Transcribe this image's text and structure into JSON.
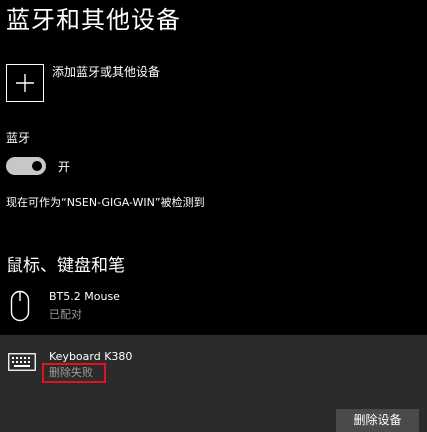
{
  "page": {
    "title": "蓝牙和其他设备"
  },
  "add_device": {
    "label": "添加蓝牙或其他设备",
    "icon": "plus-icon"
  },
  "bluetooth": {
    "label": "蓝牙",
    "toggle_on": true,
    "state_label": "开",
    "discoverable_text": "现在可作为“NSEN-GIGA-WIN”被检测到"
  },
  "section": {
    "title": "鼠标、键盘和笔"
  },
  "devices": [
    {
      "name": "BT5.2 Mouse",
      "status": "已配对",
      "icon": "mouse-icon"
    },
    {
      "name": "Keyboard K380",
      "status": "删除失败",
      "icon": "keyboard-icon",
      "selected": true,
      "remove_label": "删除设备"
    }
  ],
  "colors": {
    "background": "#000000",
    "selected_row": "#2b2b2b",
    "highlight_border": "#e0131e",
    "toggle_on": "#c7c7c7",
    "button_bg": "#4a4a4a"
  }
}
